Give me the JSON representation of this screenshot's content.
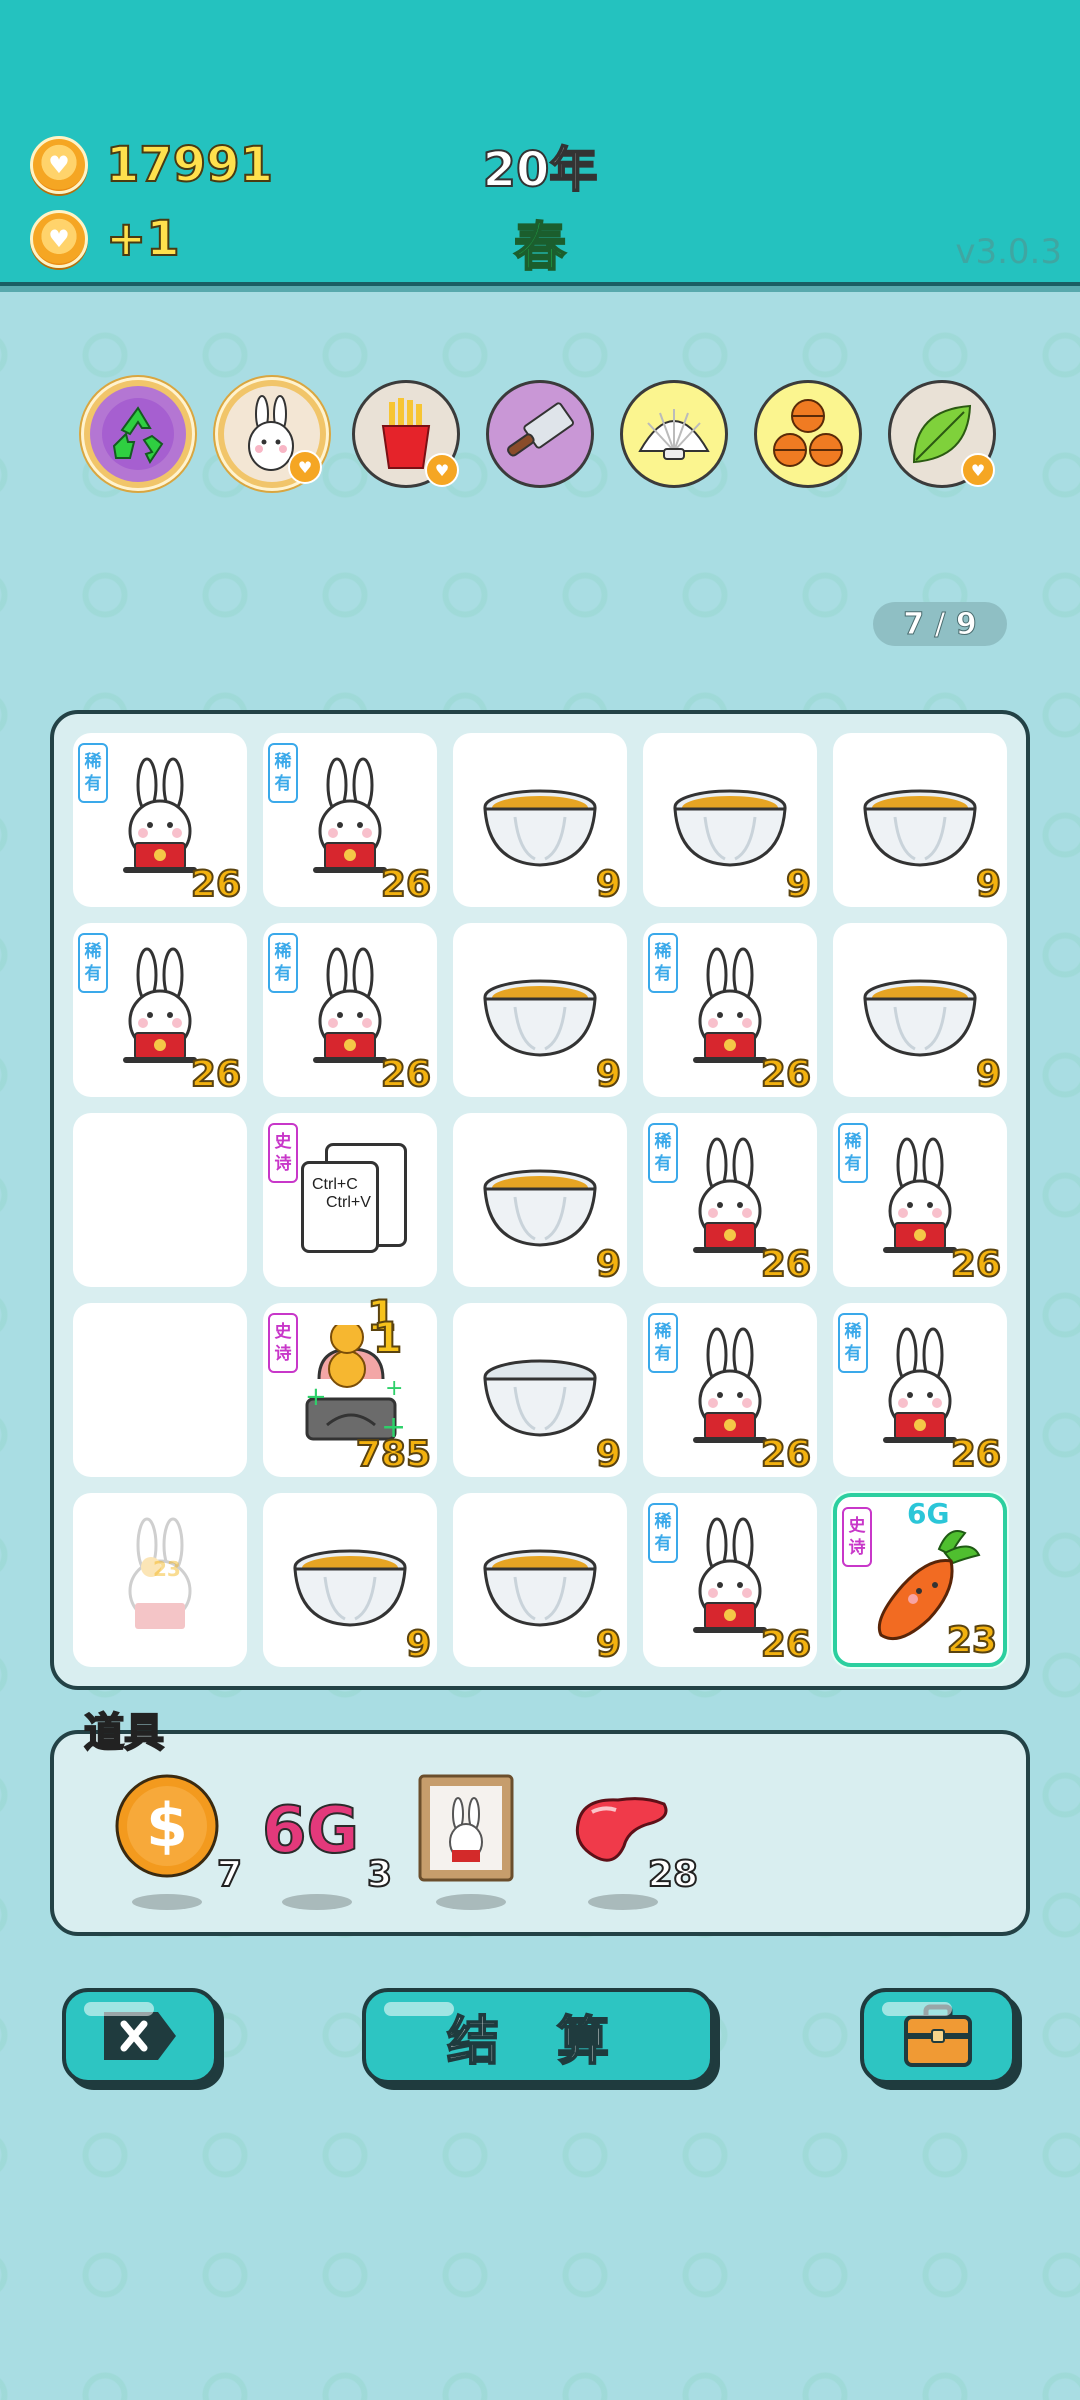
{
  "header": {
    "coins": "17991",
    "coin_rate": "+1",
    "year": "20年",
    "season": "春",
    "version": "v3.0.3"
  },
  "categories": [
    {
      "name": "recycle-icon",
      "bg": "#b476d3"
    },
    {
      "name": "rabbit-icon",
      "bg": "#f3e6d4"
    },
    {
      "name": "fries-icon",
      "bg": "#e9e1d6"
    },
    {
      "name": "cleaver-icon",
      "bg": "#c997d6"
    },
    {
      "name": "shell-icon",
      "bg": "#fbf58f"
    },
    {
      "name": "basketballs-icon",
      "bg": "#fbf58f"
    },
    {
      "name": "leaf-icon",
      "bg": "#e9e1d6"
    }
  ],
  "page_indicator": "7 / 9",
  "tags": {
    "rare": [
      "稀",
      "有"
    ],
    "epic": [
      "史",
      "诗"
    ]
  },
  "board": {
    "copy_paste": {
      "line1": "Ctrl+C",
      "line2": "Ctrl+V"
    },
    "cells": [
      {
        "icon": "rabbit",
        "tag": "rare",
        "value": "26"
      },
      {
        "icon": "rabbit",
        "tag": "rare",
        "value": "26"
      },
      {
        "icon": "bowl",
        "value": "9"
      },
      {
        "icon": "bowl",
        "value": "9"
      },
      {
        "icon": "bowl",
        "value": "9"
      },
      {
        "icon": "rabbit",
        "tag": "rare",
        "value": "26"
      },
      {
        "icon": "rabbit",
        "tag": "rare",
        "value": "26"
      },
      {
        "icon": "bowl",
        "value": "9"
      },
      {
        "icon": "rabbit",
        "tag": "rare",
        "value": "26"
      },
      {
        "icon": "bowl",
        "value": "9"
      },
      {
        "icon": "empty"
      },
      {
        "icon": "copy-paste",
        "tag": "epic"
      },
      {
        "icon": "bowl",
        "value": "9"
      },
      {
        "icon": "rabbit",
        "tag": "rare",
        "value": "26"
      },
      {
        "icon": "rabbit",
        "tag": "rare",
        "value": "26"
      },
      {
        "icon": "empty"
      },
      {
        "icon": "iron",
        "tag": "epic",
        "value": "785",
        "floats": [
          "1",
          "1"
        ]
      },
      {
        "icon": "empty-bowl",
        "value": "9"
      },
      {
        "icon": "rabbit",
        "tag": "rare",
        "value": "26"
      },
      {
        "icon": "rabbit",
        "tag": "rare",
        "value": "26"
      },
      {
        "icon": "ghost-rabbit",
        "ghost_value": "23"
      },
      {
        "icon": "bowl",
        "value": "9"
      },
      {
        "icon": "bowl",
        "value": "9"
      },
      {
        "icon": "rabbit",
        "tag": "rare",
        "value": "26"
      },
      {
        "icon": "carrot",
        "tag": "epic",
        "value": "23",
        "top_label": "6G",
        "selected": true
      }
    ]
  },
  "props": {
    "title": "道具",
    "items": [
      {
        "name": "dollar-coin",
        "count": "7"
      },
      {
        "name": "6g-badge",
        "label": "6G",
        "count": "3"
      },
      {
        "name": "rabbit-painting",
        "count": ""
      },
      {
        "name": "liver",
        "count": "28"
      }
    ]
  },
  "buttons": {
    "settle": "结 算"
  },
  "colors": {
    "header": "#24c2bf",
    "background": "#a9dde3",
    "accent": "#2dc5c2"
  }
}
